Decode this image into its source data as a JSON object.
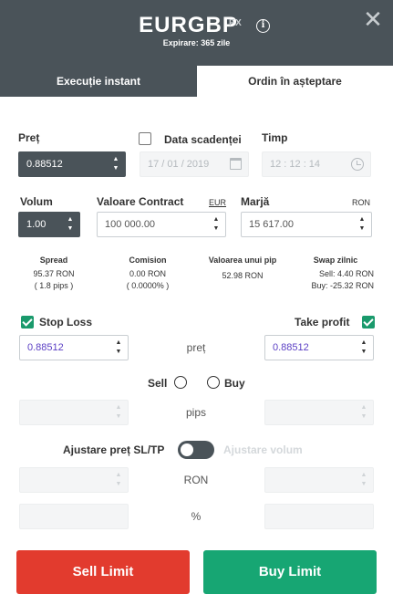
{
  "header": {
    "symbol": "EURGBP",
    "badge": "FX",
    "info_glyph": "i",
    "expiry": "Expirare: 365 zile",
    "close_glyph": "✕"
  },
  "tabs": {
    "instant": "Execuție instant",
    "pending": "Ordin în așteptare",
    "active": "pending"
  },
  "order": {
    "price_label": "Preț",
    "price_value": "0.88512",
    "expiry_date_label": "Data scadenței",
    "date_value": "17 / 01 / 2019",
    "time_label": "Timp",
    "time_value": "12 : 12 : 14",
    "volume_label": "Volum",
    "volume_value": "1.00",
    "contract_label": "Valoare Contract",
    "contract_currency": "EUR",
    "contract_value": "100 000.00",
    "margin_label": "Marjă",
    "margin_currency": "RON",
    "margin_value": "15 617.00"
  },
  "info": {
    "spread": {
      "title": "Spread",
      "line1": "95.37 RON",
      "line2": "( 1.8 pips )"
    },
    "commission": {
      "title": "Comision",
      "line1": "0.00 RON",
      "line2": "( 0.0000% )"
    },
    "pip_value": {
      "title": "Valoarea unui pip",
      "line1": "52.98 RON"
    },
    "swap": {
      "title": "Swap zilnic",
      "line1": "Sell: 4.40 RON",
      "line2": "Buy: -25.32 RON"
    }
  },
  "sltp": {
    "stop_loss_label": "Stop Loss",
    "take_profit_label": "Take profit",
    "stop_loss_checked": true,
    "take_profit_checked": true,
    "sl_price": "0.88512",
    "tp_price": "0.88512",
    "price_row_label": "preț",
    "sell_label": "Sell",
    "buy_label": "Buy",
    "pips_row_label": "pips",
    "adjust_price_label": "Ajustare preț SL/TP",
    "adjust_volume_label": "Ajustare volum",
    "ron_row_label": "RON",
    "pct_row_label": "%"
  },
  "actions": {
    "sell_limit": "Sell Limit",
    "buy_limit": "Buy Limit"
  },
  "colors": {
    "header_bg": "#4a5359",
    "sell": "#e23b2e",
    "buy": "#17a673",
    "checkbox": "#1a9a6c",
    "value_text": "#5b3fc4"
  }
}
